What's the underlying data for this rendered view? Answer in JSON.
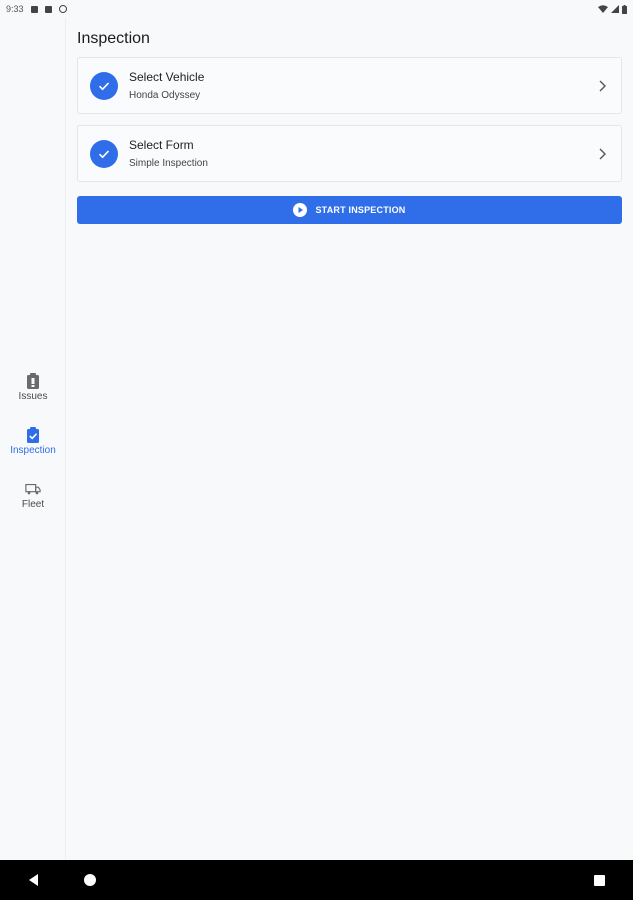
{
  "status_bar": {
    "time": "9:33",
    "icons": [
      "notification-icon",
      "sim-icon",
      "sync-icon"
    ],
    "right_icons": [
      "wifi-icon",
      "signal-icon",
      "battery-icon"
    ]
  },
  "nav_rail": {
    "items": [
      {
        "label": "Issues",
        "icon": "clipboard-icon",
        "active": false
      },
      {
        "label": "Inspection",
        "icon": "clipboard-check-icon",
        "active": true
      },
      {
        "label": "Fleet",
        "icon": "truck-icon",
        "active": false
      }
    ]
  },
  "main": {
    "title": "Inspection",
    "cards": [
      {
        "title": "Select Vehicle",
        "subtitle": "Honda Odyssey",
        "completed": true
      },
      {
        "title": "Select Form",
        "subtitle": "Simple Inspection",
        "completed": true
      }
    ],
    "start_button": {
      "label": "START INSPECTION"
    }
  },
  "colors": {
    "accent": "#2f6ee8",
    "background": "#f8f9fb",
    "android_nav": "#000000"
  }
}
